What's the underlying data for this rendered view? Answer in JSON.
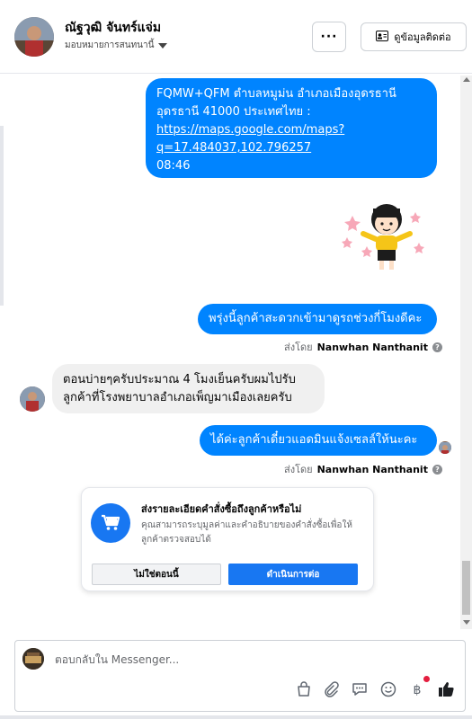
{
  "header": {
    "contact_name": "ณัฐวุฒิ จันทร์แจ่ม",
    "assign_label": "มอบหมายการสนทนานี้",
    "more_label": "···",
    "view_contact_label": "ดูข้อมูลติดต่อ"
  },
  "messages": {
    "location": {
      "line1": "FQMW+QFM ตำบลหมูม่น อำเภอเมืองอุดรธานี",
      "line2": "อุดรธานี 41000 ประเทศไทย :",
      "link_line1": "https://maps.google.com/maps?",
      "link_line2": "q=17.484037,102.796257",
      "time": "08:46"
    },
    "question": "พรุ่งนี้ลูกค้าสะดวกเข้ามาดูรถช่วงกี่โมงดีคะ",
    "sent_by_1": {
      "prefix": "ส่งโดย",
      "name": "Nanwhan Nanthanit"
    },
    "reply_line1": "ตอนบ่ายๆครับประมาณ 4 โมงเย็นครับผมไปรับ",
    "reply_line2": "ลูกค้าที่โรงพยาบาลอำเภอเพ็ญมาเมืองเลยครับ",
    "ack": "ได้ค่ะลูกค้าเดี๋ยวแอดมินแจ้งเซลล์ให้นะคะ",
    "sent_by_2": {
      "prefix": "ส่งโดย",
      "name": "Nanwhan Nanthanit"
    }
  },
  "order_card": {
    "title": "ส่งรายละเอียดคำสั่งซื้อถึงลูกค้าหรือไม่",
    "description": "คุณสามารถระบุมูลค่าและคำอธิบายของคำสั่งซื้อเพื่อให้ลูกค้าตรวจสอบได้",
    "no_label": "ไม่ใช่ตอนนี้",
    "continue_label": "ดำเนินการต่อ"
  },
  "composer": {
    "placeholder": "ตอบกลับใน Messenger...",
    "tools": [
      "bag-icon",
      "paperclip-icon",
      "saved-reply-icon",
      "emoji-icon",
      "baht-icon",
      "like-icon"
    ]
  },
  "colors": {
    "accent": "#1877f2",
    "bubble_out": "#0084ff",
    "bubble_in": "#f0f0f0",
    "notification_dot": "#e41e3f"
  }
}
